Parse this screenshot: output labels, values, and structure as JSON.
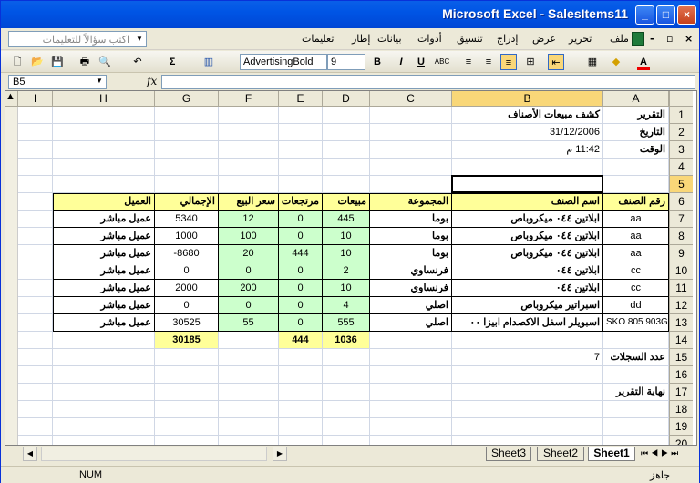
{
  "window": {
    "title": "Microsoft Excel - SalesItems11",
    "min": "_",
    "max": "□",
    "close": "×"
  },
  "menu": {
    "items": [
      "ملف",
      "تحرير",
      "عرض",
      "إدراج",
      "تنسيق",
      "أدوات",
      "بيانات",
      "إطار",
      "تعليمات"
    ],
    "help_placeholder": "اكتب سؤالاً للتعليمات",
    "restore": "▫",
    "close": "×",
    "minus": "-"
  },
  "toolbar": {
    "font": "AdvertisingBold",
    "size": "9",
    "bold": "B",
    "italic": "I",
    "underline": "U",
    "sum": "Σ",
    "abc": "ABC",
    "font_color_letter": "A"
  },
  "formula": {
    "name_box": "B5",
    "fx": "fx",
    "value": ""
  },
  "columns": [
    "I",
    "H",
    "G",
    "F",
    "E",
    "D",
    "C",
    "B",
    "A"
  ],
  "selected_column": "B",
  "rows": [
    "1",
    "2",
    "3",
    "4",
    "5",
    "6",
    "7",
    "8",
    "9",
    "10",
    "11",
    "12",
    "13",
    "14",
    "15",
    "16",
    "17",
    "18",
    "19",
    "20"
  ],
  "report": {
    "title_label": "التقرير",
    "title": "كشف مبيعات الأصناف",
    "date_label": "التاريخ",
    "date": "31/12/2006",
    "time_label": "الوقت",
    "time": "11:42 م",
    "headers": {
      "code": "رقم الصنف",
      "name": "اسم الصنف",
      "group": "المجموعة",
      "sales": "مبيعات",
      "returns": "مرتجعات",
      "price": "سعر البيع",
      "total": "الإجمالي",
      "customer": "العميل"
    },
    "rows": [
      {
        "code": "aa",
        "name": "ابلاتين ٠٤٤ ميكروباص",
        "group": "بوما",
        "sales": "445",
        "returns": "0",
        "price": "12",
        "total": "5340",
        "customer": "عميل مباشر"
      },
      {
        "code": "aa",
        "name": "ابلاتين ٠٤٤ ميكروباص",
        "group": "بوما",
        "sales": "10",
        "returns": "0",
        "price": "100",
        "total": "1000",
        "customer": "عميل مباشر"
      },
      {
        "code": "aa",
        "name": "ابلاتين ٠٤٤ ميكروباص",
        "group": "بوما",
        "sales": "10",
        "returns": "444",
        "price": "20",
        "total": "-8680",
        "customer": "عميل مباشر"
      },
      {
        "code": "cc",
        "name": "ابلاتين ٠٤٤",
        "group": "فرنساوي",
        "sales": "2",
        "returns": "0",
        "price": "0",
        "total": "0",
        "customer": "عميل مباشر"
      },
      {
        "code": "cc",
        "name": "ابلاتين ٠٤٤",
        "group": "فرنساوي",
        "sales": "10",
        "returns": "0",
        "price": "200",
        "total": "2000",
        "customer": "عميل مباشر"
      },
      {
        "code": "dd",
        "name": "اسبراتير ميكروباص",
        "group": "اصلي",
        "sales": "4",
        "returns": "0",
        "price": "0",
        "total": "0",
        "customer": "عميل مباشر"
      },
      {
        "code": "SKO 805 903G",
        "name": "اسبويلر اسفل الاكصدام ابيزا ٠٠",
        "group": "اصلي",
        "sales": "555",
        "returns": "0",
        "price": "55",
        "total": "30525",
        "customer": "عميل مباشر"
      }
    ],
    "totals": {
      "sales": "1036",
      "returns": "444",
      "total": "30185"
    },
    "records_label": "عدد السجلات",
    "records": "7",
    "end_label": "نهاية التقرير"
  },
  "tabs": [
    "Sheet1",
    "Sheet2",
    "Sheet3"
  ],
  "active_tab": "Sheet1",
  "status": {
    "left": "جاهز",
    "num": "NUM"
  },
  "colors": {
    "header_fill": "#FFFF99",
    "number_fill": "#CCFFCC",
    "total_fill": "#FFFF99",
    "title_blue": "#0055E5"
  }
}
